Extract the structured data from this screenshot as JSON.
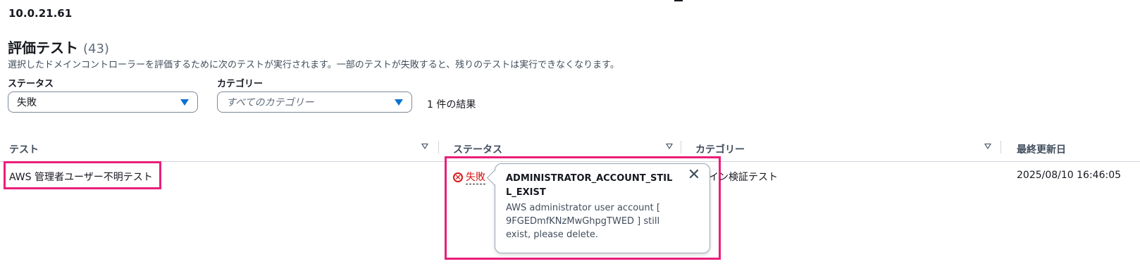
{
  "header": {
    "ip": "10.0.21.61"
  },
  "section": {
    "title": "評価テスト",
    "count": "(43)",
    "description": "選択したドメインコントローラーを評価するために次のテストが実行されます。一部のテストが失敗すると、残りのテストは実行できなくなります。"
  },
  "filters": {
    "status_label": "ステータス",
    "status_value": "失敗",
    "category_label": "カテゴリー",
    "category_placeholder": "すべてのカテゴリー",
    "results": "1 件の結果"
  },
  "table": {
    "columns": [
      "テスト",
      "ステータス",
      "カテゴリー",
      "最終更新日"
    ],
    "rows": [
      {
        "test": "AWS 管理者ユーザー不明テスト",
        "status": "失敗",
        "category": "メイン検証テスト",
        "updated": "2025/08/10 16:46:05"
      }
    ]
  },
  "popover": {
    "title": "ADMINISTRATOR_ACCOUNT_STILL_EXIST",
    "body": "AWS administrator user account [ 9FGEDmfKNzMwGhpgTWED ] still exist, please delete.",
    "close_icon": "close-icon"
  },
  "colors": {
    "accent": "#0972d3",
    "error": "#d91515",
    "highlight": "#ea1f7a"
  }
}
